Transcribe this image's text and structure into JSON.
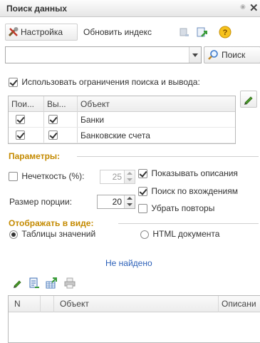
{
  "window": {
    "title": "Поиск данных"
  },
  "toolbar": {
    "settings_label": "Настройка",
    "update_index_label": "Обновить индекс"
  },
  "search": {
    "query_value": "",
    "button_label": "Поиск"
  },
  "restrictions": {
    "use_label": "Использовать ограничения поиска и вывода:",
    "use_checked": true,
    "columns": [
      "Пои...",
      "Вы...",
      "Объект"
    ],
    "rows": [
      {
        "search": true,
        "output": true,
        "object": "Банки"
      },
      {
        "search": true,
        "output": true,
        "object": "Банковские счета"
      }
    ]
  },
  "parameters": {
    "title": "Параметры:",
    "fuzziness_label": "Нечеткость (%):",
    "fuzziness_checked": false,
    "fuzziness_value": "25",
    "portion_label": "Размер порции:",
    "portion_value": "20",
    "show_descriptions_label": "Показывать описания",
    "show_descriptions_checked": true,
    "search_occurrences_label": "Поиск по вхождениям",
    "search_occurrences_checked": true,
    "remove_duplicates_label": "Убрать повторы",
    "remove_duplicates_checked": false
  },
  "display": {
    "title": "Отображать в виде:",
    "option_tables": "Таблицы значений",
    "option_html": "HTML документа",
    "selected": "Таблицы значений"
  },
  "results": {
    "status": "Не найдено",
    "columns": [
      "N",
      "Объект",
      "Описани"
    ]
  },
  "colors": {
    "section_title": "#c48a00",
    "status_link": "#2a5fb8"
  }
}
